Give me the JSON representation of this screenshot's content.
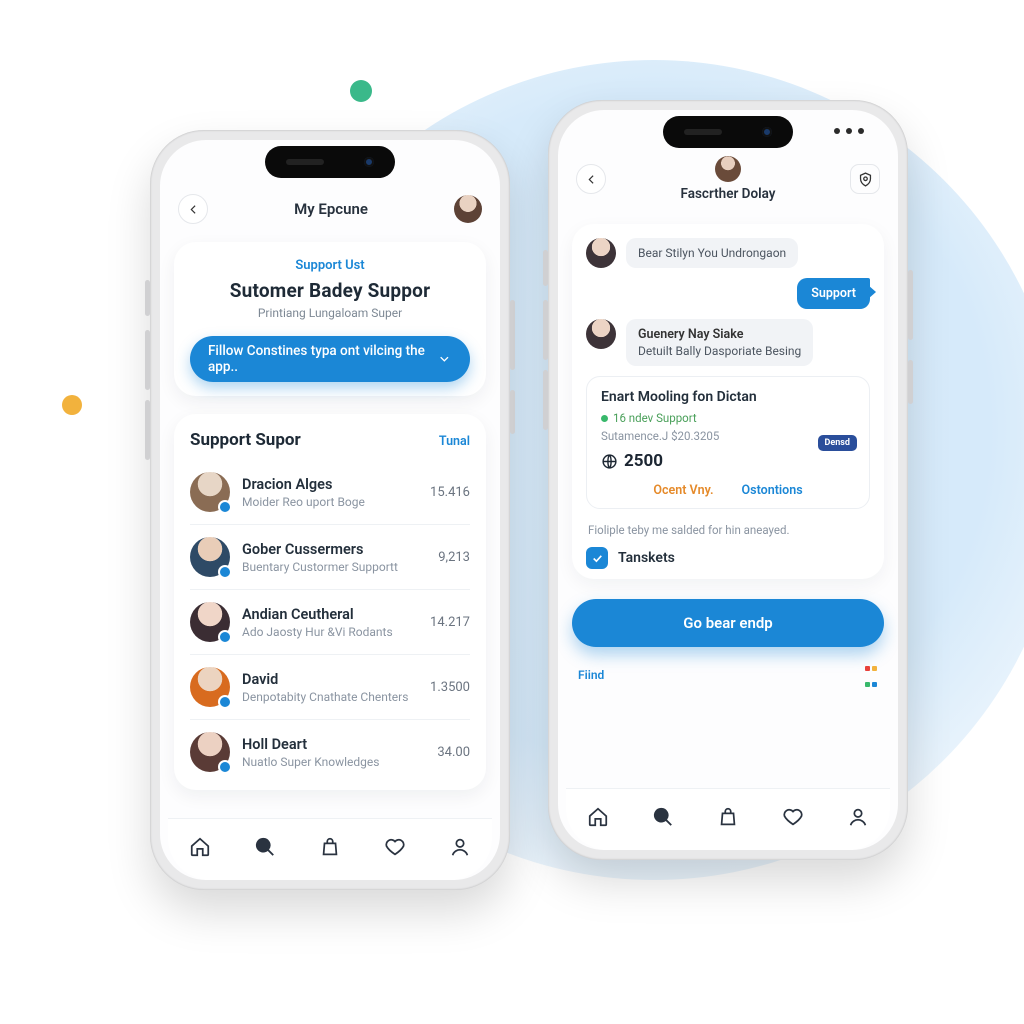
{
  "colors": {
    "accent": "#1b87d6",
    "success": "#38b86b",
    "warn": "#e58a2a",
    "chip": "#2a4e9b"
  },
  "left": {
    "header": {
      "title": "My Epcune"
    },
    "hero": {
      "tag": "Support Ust",
      "title": "Sutomer Badey Suppor",
      "subtitle": "Printiang Lungaloam Super"
    },
    "dropdown": {
      "label": "Fillow Constines typa ont vilcing the app.."
    },
    "list": {
      "title": "Support Supor",
      "action": "Tunal",
      "items": [
        {
          "name": "Dracion Alges",
          "desc": "Moider Reo uport Boge",
          "value": "15.416"
        },
        {
          "name": "Gober Cussermers",
          "desc": "Buentary Custormer Supportt",
          "value": "9,213"
        },
        {
          "name": "Andian Ceutheral",
          "desc": "Ado Jaosty Hur &Vi Rodants",
          "value": "14.217"
        },
        {
          "name": "David",
          "desc": "Denpotabity Cnathate Chenters",
          "value": "1.3500"
        },
        {
          "name": "Holl Deart",
          "desc": "Nuatlo Super Knowledges",
          "value": "34.00"
        }
      ]
    }
  },
  "right": {
    "header": {
      "title": "Fascrther Dolay"
    },
    "messages": {
      "in1": "Bear Stilyn You Undrongaon",
      "out1": "Support",
      "in2_title": "Guenery Nay Siake",
      "in2_sub": "Detuilt Bally Dasporiate Besing"
    },
    "ticket": {
      "title": "Enart Mooling fon Dictan",
      "status": "16 ndev Support",
      "detail": "Sutamence.J $20.3205",
      "amount": "2500",
      "chip": "Densd"
    },
    "tabs": {
      "a": "Ocent Vny.",
      "b": "Ostontions"
    },
    "note": "Fioliple teby me salded for hin aneayed.",
    "checkbox": {
      "label": "Tanskets"
    },
    "cta": "Go bear endp",
    "find": "Fiind"
  },
  "nav": [
    "home",
    "search",
    "bag",
    "heart",
    "profile"
  ]
}
